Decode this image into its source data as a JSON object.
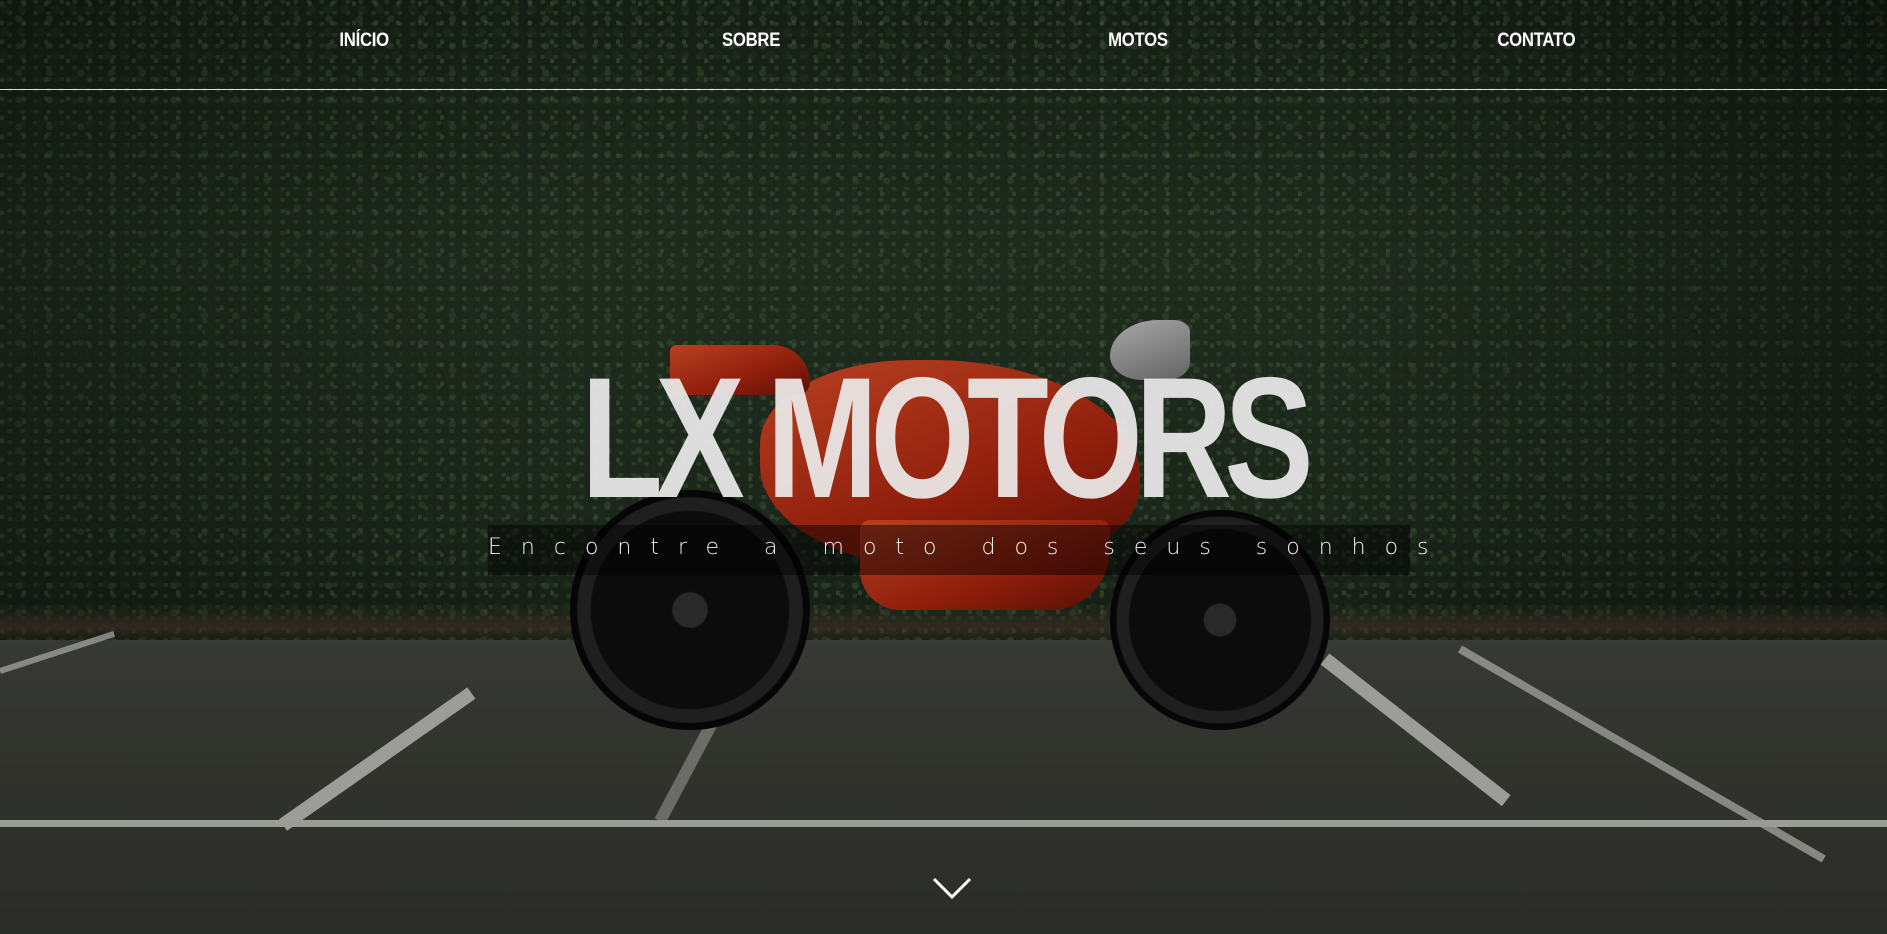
{
  "nav": {
    "items": [
      {
        "label": "INÍCIO"
      },
      {
        "label": "SOBRE"
      },
      {
        "label": "MOTOS"
      },
      {
        "label": "CONTATO"
      }
    ]
  },
  "hero": {
    "brand": "LX MOTORS",
    "tagline": "Encontre a moto dos seus sonhos",
    "scroll_icon": "chevron-down-icon"
  },
  "colors": {
    "text": "#ffffff",
    "accent_red": "#d63a18"
  }
}
